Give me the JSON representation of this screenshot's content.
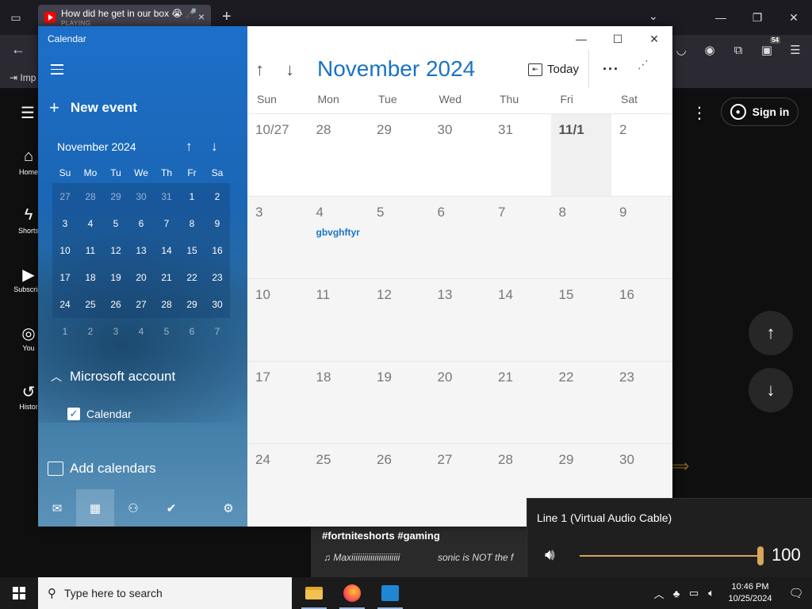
{
  "browser": {
    "tab_title": "How did he get in our box 😭 🎤",
    "tab_status": "PLAYING",
    "new_tab": "+",
    "import_label": "Imp"
  },
  "youtube": {
    "sidebar": [
      {
        "label": "Home",
        "icon": "home-icon"
      },
      {
        "label": "Shorts",
        "icon": "shorts-icon"
      },
      {
        "label": "Subscript",
        "icon": "subscriptions-icon"
      },
      {
        "label": "You",
        "icon": "you-icon"
      },
      {
        "label": "Histor",
        "icon": "history-icon"
      }
    ],
    "sign_in": "Sign in",
    "hashtags": "#fortniteshorts #gaming",
    "music_left": "♫ Maxiiiiiiiiiiiiiiiiiiiiiii",
    "music_right": "sonic is NOT the f"
  },
  "calendar": {
    "app_title": "Calendar",
    "new_event": "New event",
    "mini": {
      "month": "November 2024",
      "dow": [
        "Su",
        "Mo",
        "Tu",
        "We",
        "Th",
        "Fr",
        "Sa"
      ],
      "weeks": [
        [
          "27",
          "28",
          "29",
          "30",
          "31",
          "1",
          "2"
        ],
        [
          "3",
          "4",
          "5",
          "6",
          "7",
          "8",
          "9"
        ],
        [
          "10",
          "11",
          "12",
          "13",
          "14",
          "15",
          "16"
        ],
        [
          "17",
          "18",
          "19",
          "20",
          "21",
          "22",
          "23"
        ],
        [
          "24",
          "25",
          "26",
          "27",
          "28",
          "29",
          "30"
        ],
        [
          "1",
          "2",
          "3",
          "4",
          "5",
          "6",
          "7"
        ]
      ]
    },
    "account": "Microsoft account",
    "calendar_item": "Calendar",
    "calendar_checked": true,
    "add_calendars": "Add calendars",
    "main": {
      "month_title": "November 2024",
      "today": "Today",
      "more": "···",
      "dow": [
        "Sun",
        "Mon",
        "Tue",
        "Wed",
        "Thu",
        "Fri",
        "Sat"
      ],
      "weeks": [
        [
          "10/27",
          "28",
          "29",
          "30",
          "31",
          "11/1",
          "2"
        ],
        [
          "3",
          "4",
          "5",
          "6",
          "7",
          "8",
          "9"
        ],
        [
          "10",
          "11",
          "12",
          "13",
          "14",
          "15",
          "16"
        ],
        [
          "17",
          "18",
          "19",
          "20",
          "21",
          "22",
          "23"
        ],
        [
          "24",
          "25",
          "26",
          "27",
          "28",
          "29",
          "30"
        ]
      ],
      "event": {
        "day": "4",
        "title": "gbvghftyr"
      }
    }
  },
  "volume": {
    "device": "Line 1 (Virtual Audio Cable)",
    "level": 100,
    "value_label": "100",
    "accent": "#d6a65a"
  },
  "taskbar": {
    "search_placeholder": "Type here to search",
    "time": "10:46 PM",
    "date": "10/25/2024"
  },
  "colors": {
    "calendar_accent": "#1a73c5",
    "pane_blue": "#1b66b5"
  }
}
